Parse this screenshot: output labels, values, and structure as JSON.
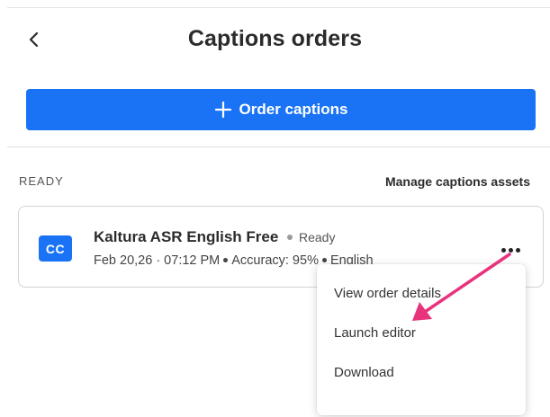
{
  "header": {
    "title": "Captions orders",
    "back_icon": "chevron-left-icon"
  },
  "order_button": {
    "label": "Order captions",
    "icon": "plus-icon"
  },
  "section": {
    "label": "READY",
    "manage_link": "Manage captions assets"
  },
  "caption_item": {
    "badge": "CC",
    "title": "Kaltura ASR English Free",
    "status": "Ready",
    "date": "Feb 20,26 · 07:12 PM",
    "accuracy": "Accuracy: 95%",
    "language": "English",
    "more_icon": "more-horizontal-icon"
  },
  "menu": {
    "items": [
      {
        "label": "View order details"
      },
      {
        "label": "Launch editor"
      },
      {
        "label": "Download"
      }
    ]
  },
  "colors": {
    "accent": "#1a73f5",
    "annotation_arrow": "#e8327c"
  }
}
